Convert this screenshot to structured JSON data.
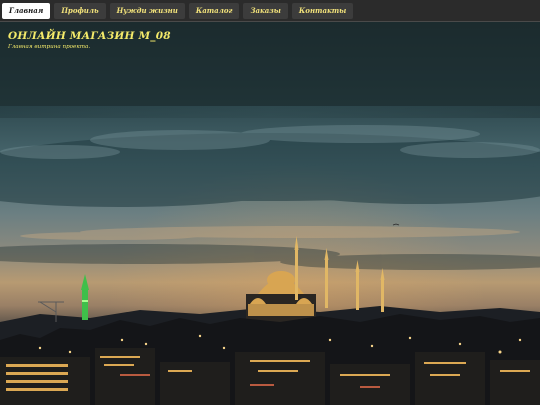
{
  "nav": {
    "items": [
      {
        "label": "Главная",
        "active": true
      },
      {
        "label": "Профиль",
        "active": false
      },
      {
        "label": "Нужди жизни",
        "active": false
      },
      {
        "label": "Каталог",
        "active": false
      },
      {
        "label": "Заказы",
        "active": false
      },
      {
        "label": "Контакты",
        "active": false
      }
    ]
  },
  "header": {
    "title": "ОНЛАЙН МАГАЗИН M_08",
    "tagline": "Главная витрина проекта."
  },
  "colors": {
    "accent": "#f4ea6a",
    "navbar": "#2b2b2b",
    "active_tab": "#ffffff"
  },
  "hero": {
    "image_subject": "night-city-skyline-mosque"
  }
}
